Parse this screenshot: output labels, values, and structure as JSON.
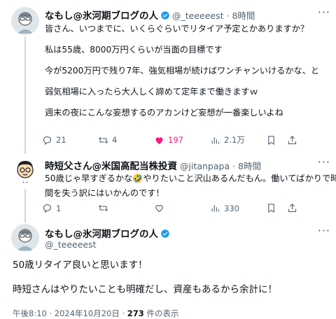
{
  "post1": {
    "display_name": "なもし@氷河期ブログの人",
    "handle": "@_teeeeest",
    "time": "8時間",
    "lines": [
      "皆さん、いつまでに、いくらぐらいでリタイア予定とかありますか？",
      "私は55歳、8000万円くらいが当面の目標です",
      "今が5200万円で残り7年、強気相場が続けばワンチャンいけるかな、と",
      "弱気相場に入ったら大人しく諦めて定年まで働きますｗ",
      "週末の夜にこんな妄想するのアカンけど妄想が一番楽しいよね"
    ],
    "replies": "21",
    "reposts": "4",
    "likes": "197",
    "views": "2.1万"
  },
  "post2": {
    "display_name": "時短父さん@米国高配当株投資",
    "handle": "@jitanpapa",
    "time": "8時間",
    "lines": [
      "50歳じゃ早すぎるかな🤣やりたいこと沢山あるんだもん。働いてばかりで時",
      "間を失う訳にはいかんのです！"
    ],
    "replies": "1",
    "reposts": "",
    "likes": "",
    "views": "330"
  },
  "post3": {
    "display_name": "なもし@氷河期ブログの人",
    "handle": "@_teeeeest",
    "lines": [
      "50歳リタイア良いと思います！",
      "時短さんはやりたいことも明確だし、資産もあるから余計に！"
    ],
    "timestamp": "午後8:10 · 2024年10月20日 ·",
    "view_count": "273",
    "view_label": "件の表示"
  },
  "colors": {
    "accent": "#1d9bf0",
    "like": "#f91880",
    "muted": "#536471"
  },
  "icons": [
    "verified-badge-icon",
    "more-icon",
    "reply-icon",
    "repost-icon",
    "like-icon",
    "views-icon",
    "bookmark-icon",
    "share-icon"
  ]
}
